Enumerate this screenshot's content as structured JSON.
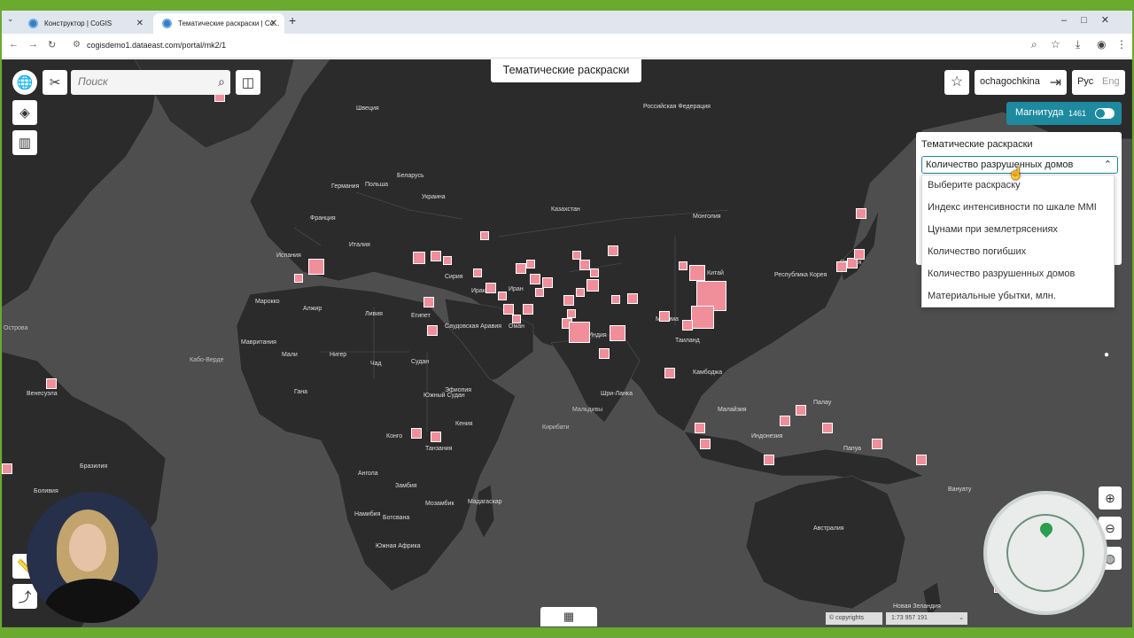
{
  "browser": {
    "tabs": [
      {
        "label": "Конструктор | CoGIS",
        "active": false
      },
      {
        "label": "Тематические раскраски | Со...",
        "active": true
      }
    ],
    "url": "cogisdemo1.dataeast.com/portal/mk2/1"
  },
  "app": {
    "title": "Тематические раскраски",
    "search": {
      "placeholder": "Поиск",
      "value": ""
    },
    "user": "ochagochkina",
    "lang": {
      "ru": "Рус",
      "en": "Eng"
    },
    "magnitude": {
      "label": "Магнитуда",
      "count": "1461",
      "enabled": true
    },
    "theme_panel": {
      "title": "Тематические раскраски",
      "selected": "Количество разрушенных домов",
      "options": [
        "Выберите раскраску",
        "Индекс интенсивности по шкале MMI",
        "Цунами при землетрясениях",
        "Количество погибших",
        "Количество разрушенных домов",
        "Материальные убытки, млн."
      ]
    },
    "footer": {
      "copyrights": "© copyrights",
      "scale": "1:73 957 191"
    }
  },
  "map": {
    "labels": [
      "Российская Федерация",
      "Казахстан",
      "Монголия",
      "Китай",
      "Республика Корея",
      "Япония",
      "Швеция",
      "Польша",
      "Беларусь",
      "Украина",
      "Германия",
      "Франция",
      "Испания",
      "Италия",
      "Алжир",
      "Ливия",
      "Египет",
      "Марокко",
      "Мавритания",
      "Мали",
      "Нигер",
      "Чад",
      "Судан",
      "Эфиопия",
      "Южный Судан",
      "Кения",
      "Танзания",
      "Конго",
      "Ангола",
      "Замбия",
      "Намибия",
      "Ботсвана",
      "Южная Африка",
      "Мадагаскар",
      "Мозамбик",
      "Сирия",
      "Ирак",
      "Иран",
      "Саудовская Аравия",
      "Оман",
      "Индия",
      "Мьянма",
      "Таиланд",
      "Камбоджа",
      "Малайзия",
      "Индонезия",
      "Папуа",
      "Палау",
      "Вануату",
      "Австралия",
      "Новая Зеландия",
      "Мальдивы",
      "Кирибати",
      "Шри-Ланка",
      "Бразилия",
      "Боливия",
      "Венесуэла",
      "Кабо-Верде",
      "Острова",
      "Гана"
    ]
  },
  "colors": {
    "accent": "#1d8aa0",
    "marker": "#f08f9a",
    "land": "#2b2b2b",
    "sea": "#4e4e4e"
  }
}
